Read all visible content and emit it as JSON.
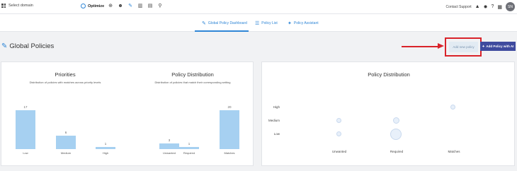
{
  "topbar": {
    "domain_label": "Select domain",
    "app_name": "Optimize",
    "contact_support": "Contact Support",
    "avatar_initials": "SN"
  },
  "tabs": [
    {
      "label": "Global Policy Dashboard",
      "icon": "hammer-icon",
      "active": true
    },
    {
      "label": "Policy List",
      "icon": "list-icon",
      "active": false
    },
    {
      "label": "Policy Assistant",
      "icon": "sparkle-icon",
      "active": false
    }
  ],
  "page": {
    "title": "Global Policies",
    "add_policy_label": "Add new policy",
    "add_ai_label": "Add Policy with AI"
  },
  "colors": {
    "accent": "#2f86d6",
    "bar": "#a6d0f1",
    "highlight": "#d9232a",
    "ai_button": "#3e4a9e"
  },
  "chart_data": [
    {
      "type": "bar",
      "title": "Priorities",
      "subtitle": "Distribution of policies with matches across priority levels",
      "categories": [
        "Low",
        "Medium",
        "High"
      ],
      "values": [
        17,
        6,
        1
      ],
      "ylim": [
        0,
        17
      ]
    },
    {
      "type": "bar",
      "title": "Policy Distribution",
      "subtitle": "Distribution of policies that match their corresponding setting",
      "categories": [
        "Unwanted",
        "Required",
        "Matches"
      ],
      "values": [
        3,
        1,
        20
      ],
      "ylim": [
        0,
        20
      ]
    },
    {
      "type": "scatter",
      "title": "Policy Distribution",
      "x_categories": [
        "Unwanted",
        "Required",
        "Matches"
      ],
      "y_categories": [
        "High",
        "Medium",
        "Low"
      ]
    }
  ]
}
